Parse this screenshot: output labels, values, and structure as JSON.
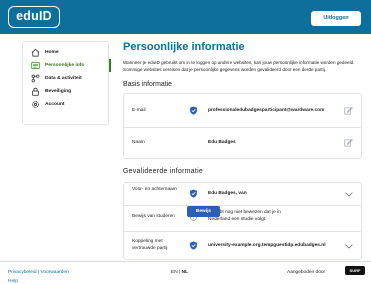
{
  "header": {
    "logo_text": "eduID",
    "logout_label": "Uitloggen",
    "brand_color": "#0d6f9c"
  },
  "sidebar": {
    "items": [
      {
        "label": "Home",
        "icon": "home-icon",
        "active": false
      },
      {
        "label": "Persoonlijke info",
        "icon": "id-card-icon",
        "active": true
      },
      {
        "label": "Data & activiteit",
        "icon": "data-nodes-icon",
        "active": false
      },
      {
        "label": "Beveiliging",
        "icon": "lock-icon",
        "active": false
      },
      {
        "label": "Account",
        "icon": "gear-icon",
        "active": false
      }
    ],
    "active_color": "#2b8a16"
  },
  "main": {
    "title": "Persoonlijke informatie",
    "intro": "Wanneer je eduID gebruikt om in te loggen op andere websites, kan jouw persoonlijke informatie worden gedeeld. Sommige websites vereisen dat je persoonlijke gegevens worden gevalideerd door een derde partij.",
    "basic": {
      "heading": "Basis informatie",
      "rows": [
        {
          "label": "E-mail",
          "value": "professionaledubadgesparticipant@wardware.com",
          "icon": "shield-check-icon",
          "action": "edit-icon"
        },
        {
          "label": "Naam",
          "value": "Edu Badges",
          "action": "edit-icon"
        }
      ]
    },
    "validated": {
      "heading": "Gevalideerde informatie",
      "rows": [
        {
          "label": "Voor- en achternaam",
          "value": "Edu Badges, van",
          "icon": "shield-check-icon",
          "action": "chevron-down-icon"
        },
        {
          "label": "Bewijs van studeren",
          "value": "Je hebt nog niet bewezen dat je in Nederland een studie volgt.",
          "icon": "shield-question-icon",
          "button": "Bewijs"
        },
        {
          "label": "Koppeling met vertrouwde partij",
          "value": "university-example.org.tempguestidp.edubadges.nl",
          "icon": "shield-check-icon",
          "action": "chevron-down-icon"
        }
      ]
    }
  },
  "footer": {
    "privacy": "Privacybeleid",
    "terms": "Voorwaarden",
    "separator": "|",
    "help": "Help",
    "lang_en": "EN",
    "lang_sep": "|",
    "lang_nl": "NL",
    "offered_by": "Aangeboden door",
    "surf_logo": "SURF"
  }
}
